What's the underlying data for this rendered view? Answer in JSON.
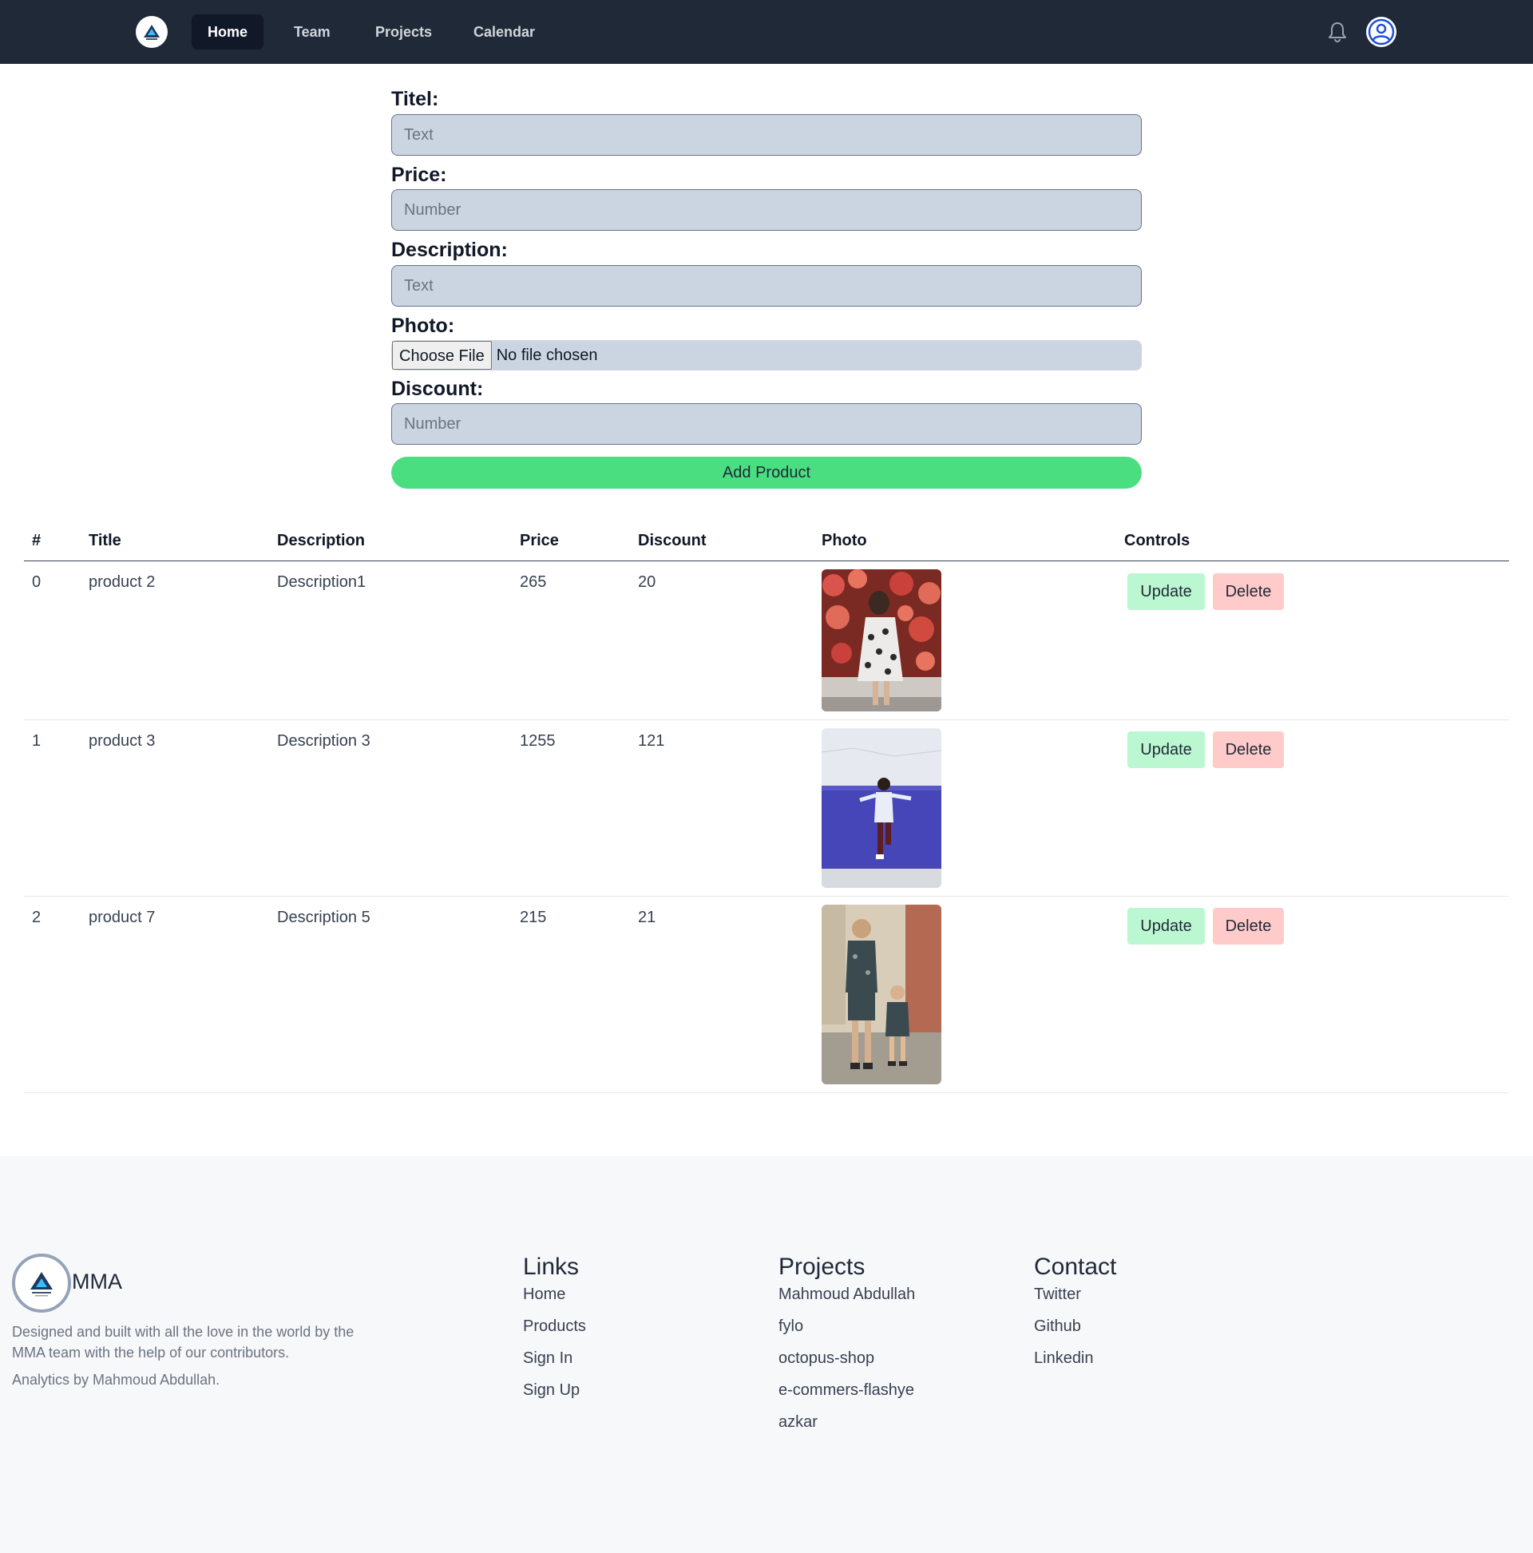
{
  "nav": {
    "items": [
      {
        "label": "Home",
        "active": true
      },
      {
        "label": "Team",
        "active": false
      },
      {
        "label": "Projects",
        "active": false
      },
      {
        "label": "Calendar",
        "active": false
      }
    ]
  },
  "form": {
    "title_label": "Titel:",
    "title_placeholder": "Text",
    "price_label": "Price:",
    "price_placeholder": "Number",
    "description_label": "Description:",
    "description_placeholder": "Text",
    "photo_label": "Photo:",
    "file_button": "Choose File",
    "file_status": "No file chosen",
    "discount_label": "Discount:",
    "discount_placeholder": "Number",
    "submit_label": "Add Product"
  },
  "table": {
    "headers": [
      "#",
      "Title",
      "Description",
      "Price",
      "Discount",
      "Photo",
      "Controls"
    ],
    "rows": [
      {
        "index": "0",
        "title": "product 2",
        "description": "Description1",
        "price": "265",
        "discount": "20",
        "photo_icon": "girl-polka-dot-dress-photo"
      },
      {
        "index": "1",
        "title": "product 3",
        "description": "Description 3",
        "price": "1255",
        "discount": "121",
        "photo_icon": "child-blue-wall-photo"
      },
      {
        "index": "2",
        "title": "product 7",
        "description": "Description 5",
        "price": "215",
        "discount": "21",
        "photo_icon": "two-boys-street-photo"
      }
    ],
    "update_label": "Update",
    "delete_label": "Delete"
  },
  "footer": {
    "brand": "MMA",
    "description": "Designed and built with all the love in the world by the MMA team with the help of our contributors.",
    "analytics": "Analytics by Mahmoud Abdullah.",
    "links_heading": "Links",
    "links": [
      "Home",
      "Products",
      "Sign In",
      "Sign Up"
    ],
    "projects_heading": "Projects",
    "projects": [
      "Mahmoud Abdullah",
      "fylo",
      "octopus-shop",
      "e-commers-flashye",
      "azkar"
    ],
    "contact_heading": "Contact",
    "contact": [
      "Twitter",
      "Github",
      "Linkedin"
    ]
  },
  "colors": {
    "navbar": "#1f2937",
    "input_bg": "#cbd5e1",
    "add_button": "#4ade80",
    "update_button": "#bbf7d0",
    "delete_button": "#fecaca",
    "footer_bg": "#f7f8fa"
  }
}
